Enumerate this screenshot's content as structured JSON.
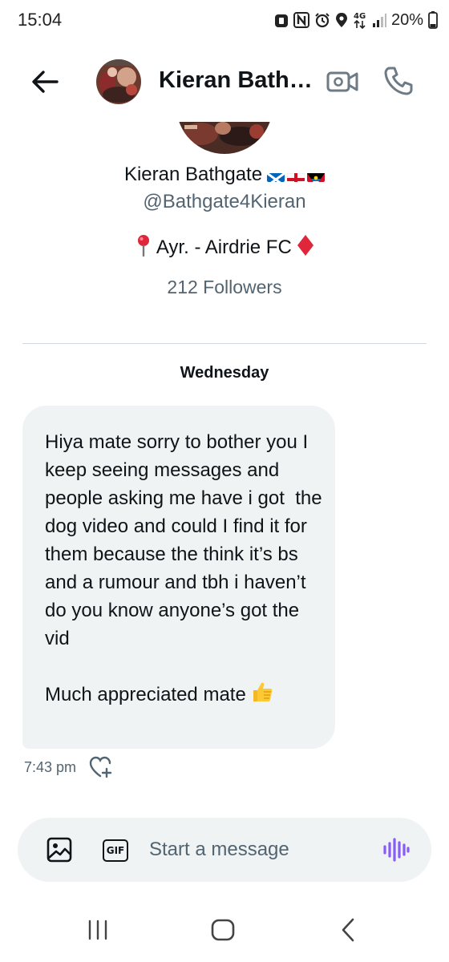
{
  "status_bar": {
    "time": "15:04",
    "network": "4G",
    "battery": "20%",
    "icons": [
      "notification-icon",
      "nfc-icon",
      "alarm-icon",
      "location-icon",
      "network-4g-icon",
      "signal-icon",
      "battery-icon"
    ]
  },
  "header": {
    "title": "Kieran Bath…",
    "back_icon": "back-arrow-icon",
    "video_icon": "video-call-icon",
    "call_icon": "phone-icon"
  },
  "profile": {
    "name": "Kieran Bathgate",
    "flags": [
      "scotland-flag",
      "england-flag",
      "antigua-flag"
    ],
    "handle": "@Bathgate4Kieran",
    "bio": "Ayr. - Airdrie FC",
    "bio_icons": [
      "pin-icon",
      "diamond-icon"
    ],
    "followers": "212 Followers"
  },
  "conversation": {
    "day_label": "Wednesday",
    "messages": [
      {
        "text": "Hiya mate sorry to bother you I keep seeing messages and people asking me have i got  the dog video and could I find it for them because the think it’s bs and a rumour and tbh i haven’t do you know anyone’s got the vid\n\nMuch appreciated mate",
        "emoji_icon": "thumbs-up-icon",
        "time": "7:43 pm"
      }
    ]
  },
  "composer": {
    "placeholder": "Start a message",
    "gif_label": "GIF",
    "media_icon": "image-icon",
    "voice_icon": "voice-icon"
  },
  "colors": {
    "text_primary": "#0f1419",
    "text_secondary": "#536471",
    "bubble_bg": "#eff3f4",
    "divider": "#cfd9de",
    "voice_accent": "#8a5cf6",
    "header_icon": "#6e7b85"
  }
}
